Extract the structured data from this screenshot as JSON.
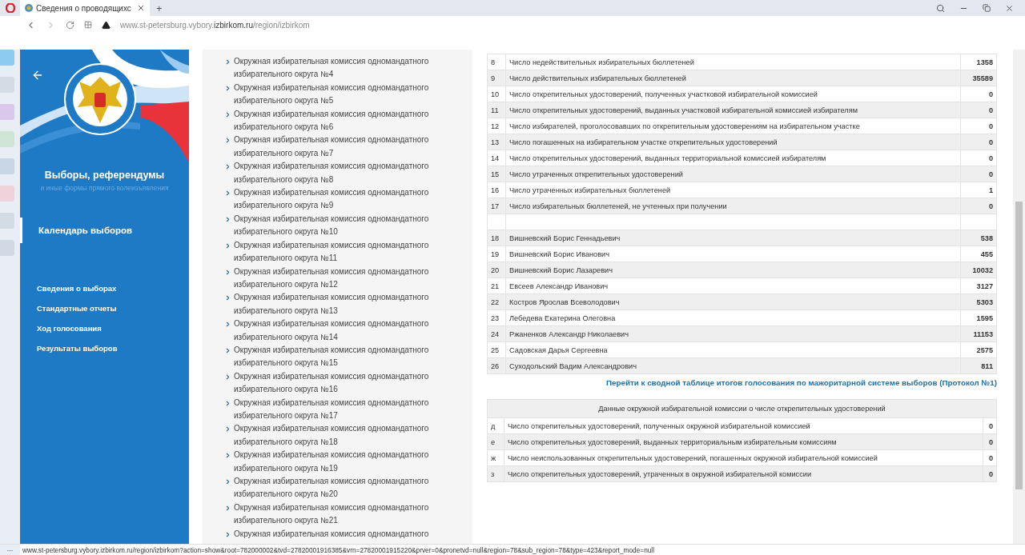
{
  "browser": {
    "tab_title": "Сведения о проводящихс",
    "new_tab": "+",
    "url_host": "www.st-petersburg.vybory.",
    "url_domain": "izbirkom.ru",
    "url_path": "/region/izbirkom",
    "status_url": "www.st-petersburg.vybory.izbirkom.ru/region/izbirkom?action=show&root=782000002&tvd=27820001916385&vrn=27820001915220&prver=0&pronetvd=null&region=78&sub_region=78&type=423&report_mode=null",
    "more": "..."
  },
  "sidebar": {
    "title": "Выборы, референдумы",
    "subtitle": "и иные формы прямого волеизъявления",
    "items": [
      {
        "label": "Календарь выборов",
        "kind": "primary",
        "selected": true
      },
      {
        "label": "Сведения о выборах",
        "kind": "secondary",
        "selected": false
      },
      {
        "label": "Стандартные отчеты",
        "kind": "secondary",
        "selected": false
      },
      {
        "label": "Ход голосования",
        "kind": "secondary",
        "selected": false
      },
      {
        "label": "Результаты выборов",
        "kind": "secondary",
        "selected": false
      }
    ]
  },
  "commissions": [
    {
      "text": "Окружная избирательная комиссия одномандатного избирательного округа №4"
    },
    {
      "text": "Окружная избирательная комиссия одномандатного избирательного округа №5"
    },
    {
      "text": "Окружная избирательная комиссия одномандатного избирательного округа №6"
    },
    {
      "text": "Окружная избирательная комиссия одномандатного избирательного округа №7"
    },
    {
      "text": "Окружная избирательная комиссия одномандатного избирательного округа №8"
    },
    {
      "text": "Окружная избирательная комиссия одномандатного избирательного округа №9"
    },
    {
      "text": "Окружная избирательная комиссия одномандатного избирательного округа №10"
    },
    {
      "text": "Окружная избирательная комиссия одномандатного избирательного округа №11"
    },
    {
      "text": "Окружная избирательная комиссия одномандатного избирательного округа №12"
    },
    {
      "text": "Окружная избирательная комиссия одномандатного избирательного округа №13"
    },
    {
      "text": "Окружная избирательная комиссия одномандатного избирательного округа №14"
    },
    {
      "text": "Окружная избирательная комиссия одномандатного избирательного округа №15"
    },
    {
      "text": "Окружная избирательная комиссия одномандатного избирательного округа №16"
    },
    {
      "text": "Окружная избирательная комиссия одномандатного избирательного округа №17"
    },
    {
      "text": "Окружная избирательная комиссия одномандатного избирательного округа №18"
    },
    {
      "text": "Окружная избирательная комиссия одномандатного избирательного округа №19"
    },
    {
      "text": "Окружная избирательная комиссия одномандатного избирательного округа №20"
    },
    {
      "text": "Окружная избирательная комиссия одномандатного избирательного округа №21"
    },
    {
      "text": "Окружная избирательная комиссия одномандатного"
    }
  ],
  "results_table": {
    "rows": [
      {
        "kind": "data",
        "number": "8",
        "label": "Число недействительных избирательных бюллетеней",
        "value": "1358"
      },
      {
        "kind": "data",
        "number": "9",
        "label": "Число действительных избирательных бюллетеней",
        "value": "35589"
      },
      {
        "kind": "data",
        "number": "10",
        "label": "Число открепительных удостоверений, полученных участковой избирательной комиссией",
        "value": "0"
      },
      {
        "kind": "data",
        "number": "11",
        "label": "Число открепительных удостоверений, выданных участковой избирательной комиссией избирателям",
        "value": "0"
      },
      {
        "kind": "data",
        "number": "12",
        "label": "Число избирателей, проголосовавших по открепительным удостоверениям на избирательном участке",
        "value": "0"
      },
      {
        "kind": "data",
        "number": "13",
        "label": "Число погашенных на избирательном участке открепительных удостоверений",
        "value": "0"
      },
      {
        "kind": "data",
        "number": "14",
        "label": "Число открепительных удостоверений, выданных территориальной комиссией избирателям",
        "value": "0"
      },
      {
        "kind": "data",
        "number": "15",
        "label": "Число утраченных открепительных удостоверений",
        "value": "0"
      },
      {
        "kind": "data",
        "number": "16",
        "label": "Число утраченных избирательных бюллетеней",
        "value": "1"
      },
      {
        "kind": "data",
        "number": "17",
        "label": "Число избирательных бюллетеней, не учтенных при получении",
        "value": "0"
      },
      {
        "kind": "blank"
      },
      {
        "kind": "data",
        "number": "18",
        "label": "Вишневский Борис Геннадьевич",
        "value": "538"
      },
      {
        "kind": "data",
        "number": "19",
        "label": "Вишневский Борис Иванович",
        "value": "455"
      },
      {
        "kind": "data",
        "number": "20",
        "label": "Вишневский Борис Лазаревич",
        "value": "10032"
      },
      {
        "kind": "data",
        "number": "21",
        "label": "Евсеев Александр Иванович",
        "value": "3127"
      },
      {
        "kind": "data",
        "number": "22",
        "label": "Костров Ярослав Всеволодович",
        "value": "5303"
      },
      {
        "kind": "data",
        "number": "23",
        "label": "Лебедева Екатерина Олеговна",
        "value": "1595"
      },
      {
        "kind": "data",
        "number": "24",
        "label": "Ржаненков Александр Николаевич",
        "value": "11153"
      },
      {
        "kind": "data",
        "number": "25",
        "label": "Садовская Дарья Сергеевна",
        "value": "2575"
      },
      {
        "kind": "data",
        "number": "26",
        "label": "Суходольский Вадим Александрович",
        "value": "811"
      }
    ]
  },
  "summary_link": "Перейти к сводной таблице итогов голосования по мажоритарной системе выборов (Протокол №1)",
  "district_table": {
    "title": "Данные окружной избирательной комиссии о числе открепительных удостоверений",
    "rows": [
      {
        "letter": "д",
        "label": "Число открепительных удостоверений, полученных окружной избирательной комиссией",
        "value": "0"
      },
      {
        "letter": "е",
        "label": "Число открепительных удостоверений, выданных территориальным избирательным комиссиям",
        "value": "0"
      },
      {
        "letter": "ж",
        "label": "Число неиспользованных открепительных удостоверений, погашенных окружной избирательной комиссией",
        "value": "0"
      },
      {
        "letter": "з",
        "label": "Число открепительных удостоверений, утраченных в окружной избирательной комиссии",
        "value": "0"
      }
    ]
  }
}
